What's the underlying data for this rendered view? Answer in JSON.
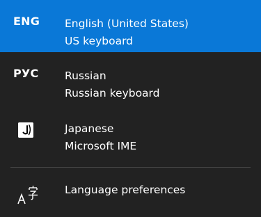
{
  "flyout": {
    "accent_color": "#0a78d7",
    "background_color": "#222222",
    "languages": [
      {
        "code": "ENG",
        "name": "English (United States)",
        "keyboard": "US keyboard",
        "selected": true
      },
      {
        "code": "РУС",
        "name": "Russian",
        "keyboard": "Russian keyboard",
        "selected": false
      },
      {
        "icon": "japanese-ime-icon",
        "name": "Japanese",
        "keyboard": "Microsoft IME",
        "selected": false
      }
    ],
    "preferences": {
      "icon": "language-settings-icon",
      "label": "Language preferences"
    }
  }
}
